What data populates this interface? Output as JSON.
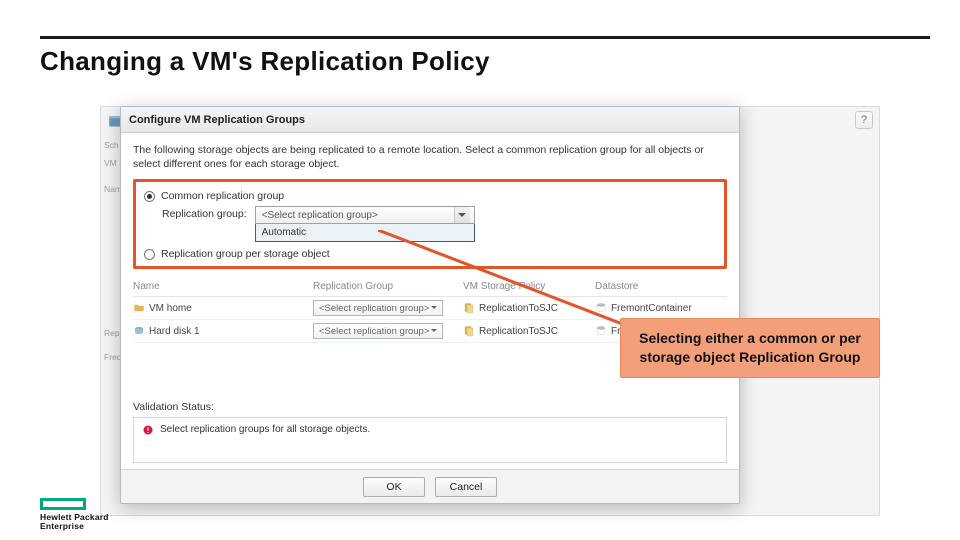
{
  "page": {
    "title": "Changing a VM's Replication Policy"
  },
  "modal": {
    "title": "Configure VM Replication Groups",
    "intro": "The following storage objects are being replicated to a remote location. Select a common replication group for all objects or select different ones for each storage object.",
    "option_common": "Common replication group",
    "option_per": "Replication group per storage object",
    "rg_label": "Replication group:",
    "rg_select_placeholder": "<Select replication group>",
    "rg_dropdown_option": "Automatic",
    "columns": {
      "name": "Name",
      "rg": "Replication Group",
      "policy": "VM Storage Policy",
      "datastore": "Datastore"
    },
    "rows": [
      {
        "name": "VM home",
        "icon": "folder",
        "rg": "<Select replication group>",
        "policy": "ReplicationToSJC",
        "datastore": "FremontContainer"
      },
      {
        "name": "Hard disk 1",
        "icon": "disk",
        "rg": "<Select replication group>",
        "policy": "ReplicationToSJC",
        "datastore": "FremontContainer"
      }
    ],
    "validation_label": "Validation Status:",
    "validation_msg": "Select replication groups for all storage objects.",
    "ok": "OK",
    "cancel": "Cancel",
    "help": "?"
  },
  "callout": {
    "text": "Selecting either a common or per storage object Replication Group"
  },
  "backdrop": {
    "left1": "Sch",
    "left2": "VM S",
    "left3": "Nam",
    "left4": "Rep",
    "left5": "Freq"
  },
  "brand": {
    "line1": "Hewlett Packard",
    "line2": "Enterprise"
  }
}
